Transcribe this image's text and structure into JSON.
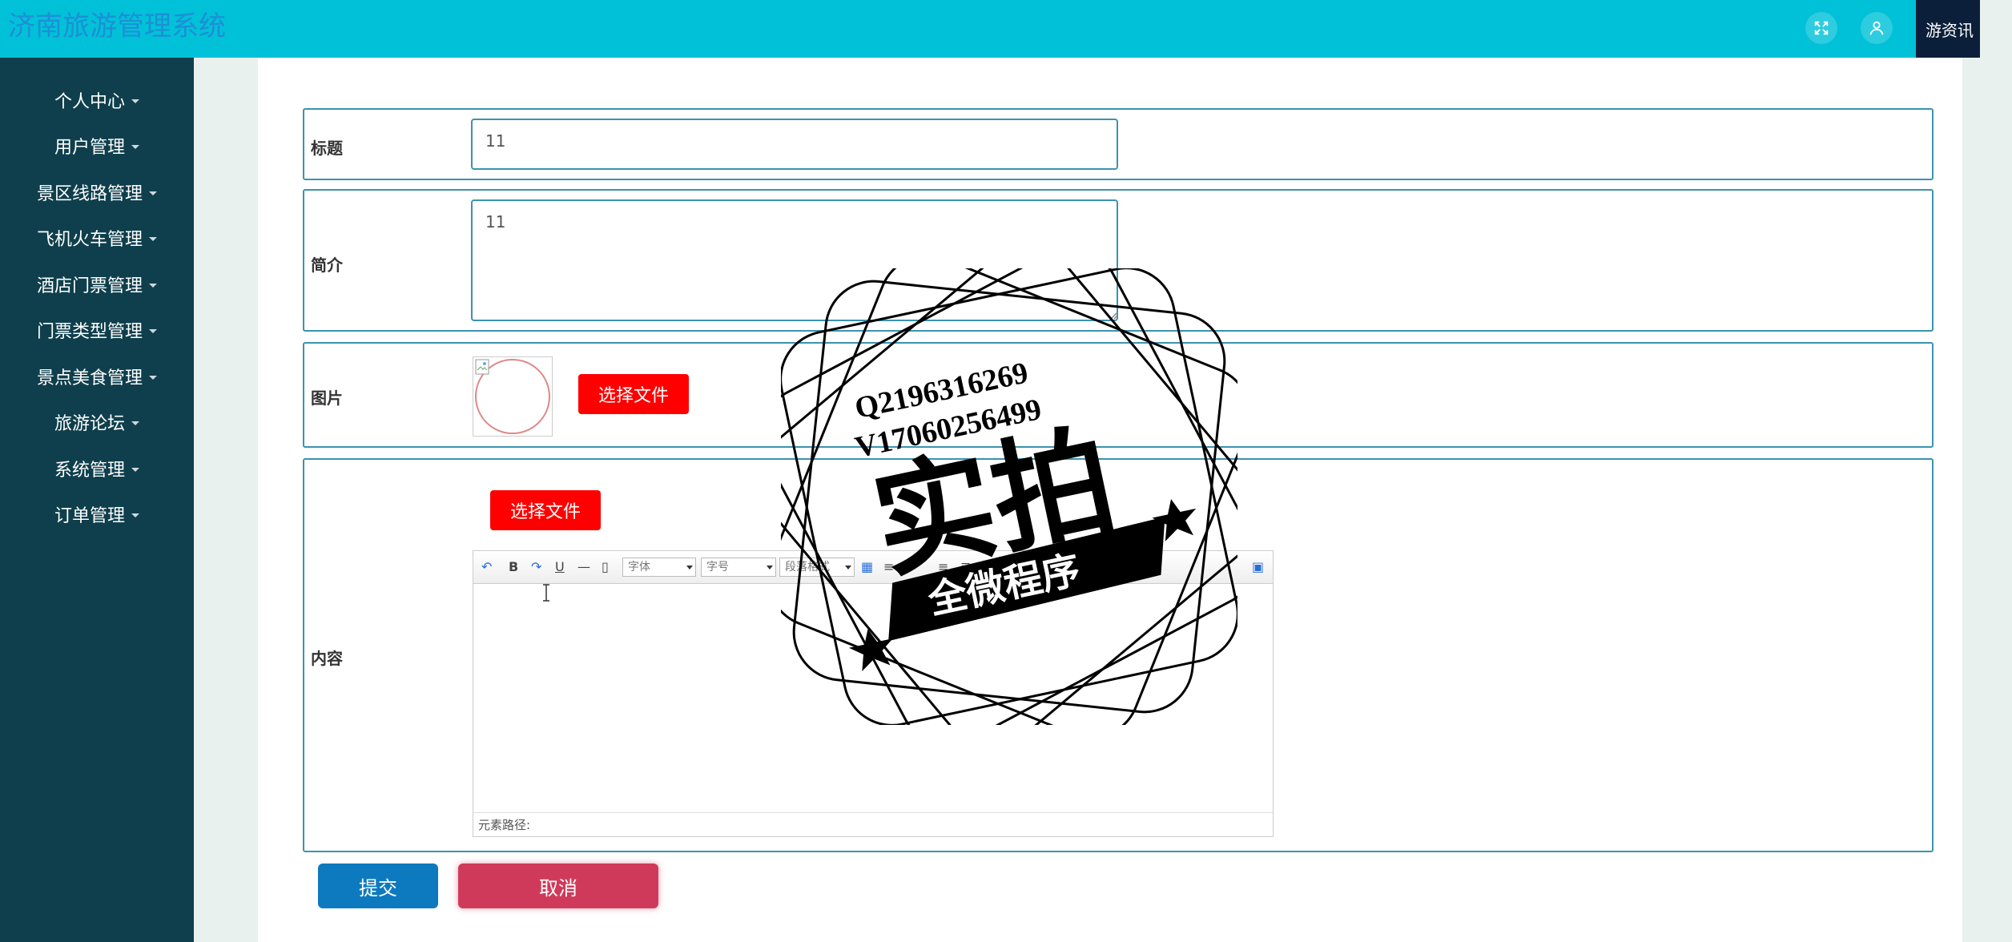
{
  "header": {
    "title": "济南旅游管理系统",
    "news_label": "游资讯",
    "fullscreen_icon": "fullscreen-icon",
    "user_icon": "user-icon"
  },
  "sidebar": {
    "items": [
      {
        "label": "个人中心"
      },
      {
        "label": "用户管理"
      },
      {
        "label": "景区线路管理"
      },
      {
        "label": "飞机火车管理"
      },
      {
        "label": "酒店门票管理"
      },
      {
        "label": "门票类型管理"
      },
      {
        "label": "景点美食管理"
      },
      {
        "label": "旅游论坛"
      },
      {
        "label": "系统管理"
      },
      {
        "label": "订单管理"
      }
    ]
  },
  "form": {
    "title_label": "标题",
    "title_value": "11",
    "intro_label": "简介",
    "intro_value": "11",
    "image_label": "图片",
    "image_upload_label": "选择文件",
    "content_label": "内容",
    "content_upload_label": "选择文件",
    "editor": {
      "font_family": "字体",
      "font_size": "字号",
      "paragraph_format": "段落格式",
      "status_path": "元素路径:"
    },
    "submit_label": "提交",
    "cancel_label": "取消"
  },
  "watermark": {
    "line1": "Q2196316269",
    "line2": "V17060256499",
    "big_text": "实拍",
    "banner_text": "全微程序"
  },
  "colors": {
    "header_bg": "#00c1d8",
    "sidebar_bg": "#0f3f4c",
    "accent_border": "#3b93b0",
    "file_button": "#ff0000",
    "submit": "#0d7abf",
    "cancel": "#d03a5a"
  }
}
